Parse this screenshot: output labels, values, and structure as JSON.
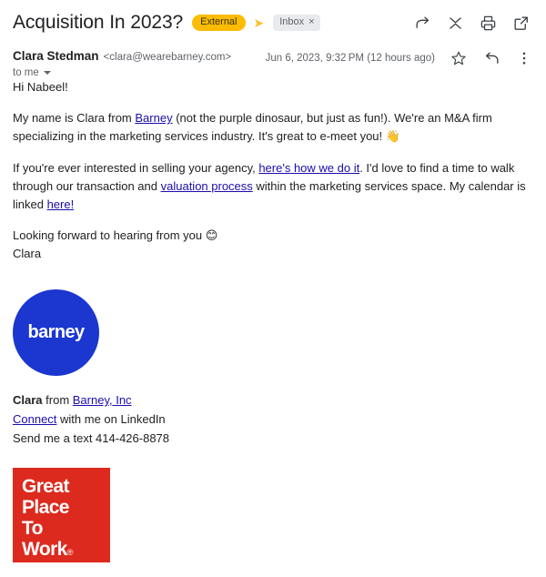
{
  "header": {
    "subject": "Acquisition In 2023?",
    "external_badge": "External",
    "chevron_icon": "double-chevron-right-icon",
    "inbox_chip": "Inbox",
    "inbox_chip_close": "×",
    "actions": [
      {
        "name": "forward-icon",
        "label": "Forward"
      },
      {
        "name": "collapse-icon",
        "label": "Collapse all"
      },
      {
        "name": "print-icon",
        "label": "Print"
      },
      {
        "name": "open-in-new-window-icon",
        "label": "Open in new window"
      }
    ]
  },
  "message": {
    "sender_name": "Clara Stedman",
    "sender_email": "<clara@wearebarney.com>",
    "recipients": "to me",
    "date": "Jun 6, 2023, 9:32 PM (12 hours ago)",
    "actions": [
      {
        "name": "star-icon",
        "label": "Star"
      },
      {
        "name": "reply-icon",
        "label": "Reply"
      },
      {
        "name": "more-options-icon",
        "label": "More"
      }
    ]
  },
  "body": {
    "greeting": "Hi Nabeel!",
    "p1_before_link": "My name is Clara from ",
    "p1_link": "Barney",
    "p1_after_link": " (not the purple dinosaur, but just as fun!). We're an M&A firm specializing in the marketing services industry. It's great to e-meet you! ",
    "p1_emoji": "👋",
    "p2_a": "If you're ever interested in selling your agency, ",
    "p2_link1": "here's how we do it",
    "p2_b": ". I'd love to find a time to walk through our transaction and ",
    "p2_link2": "valuation process",
    "p2_c": " within the marketing services space. My calendar is linked ",
    "p2_link3": "here!",
    "closing": "Looking forward to hearing from you ",
    "closing_emoji": "😊",
    "signoff": "Clara"
  },
  "logo": {
    "brand_text": "barney",
    "brand_color": "#1b37cf"
  },
  "signature": {
    "name": "Clara",
    "from_word": " from ",
    "company_link": "Barney, Inc",
    "connect_link": "Connect",
    "connect_rest": " with me on LinkedIn",
    "text_line": "Send me a text 414-426-8878"
  },
  "award_badge": {
    "line1": "Great",
    "line2": "Place",
    "line3": "To",
    "line4": "Work",
    "registered": "®",
    "color": "#dd2a1e"
  }
}
